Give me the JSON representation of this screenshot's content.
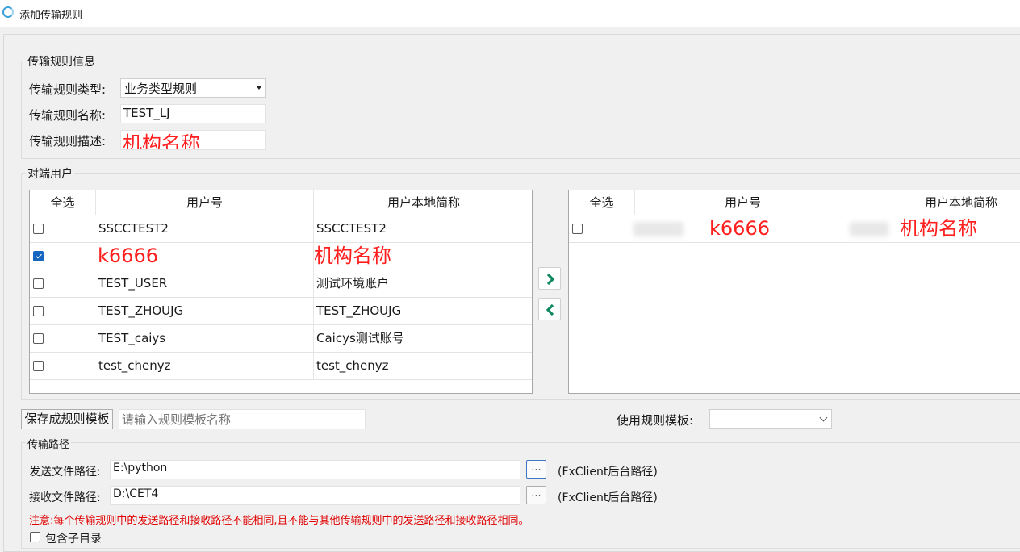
{
  "window": {
    "title": "添加传输规则"
  },
  "rule_info": {
    "group_title": "传输规则信息",
    "type_label": "传输规则类型:",
    "type_value": "业务类型规则",
    "name_label": "传输规则名称:",
    "name_value": "TEST_LJ",
    "desc_label": "传输规则描述:",
    "desc_value": "机构名称"
  },
  "peer_users": {
    "group_title": "对端用户",
    "left_table": {
      "headers": [
        "全选",
        "用户号",
        "用户本地简称"
      ],
      "rows": [
        {
          "checked": false,
          "user_id": "SSCCTEST2",
          "local_name": "SSCCTEST2"
        },
        {
          "checked": true,
          "user_id": "k6666",
          "local_name": "机构名称"
        },
        {
          "checked": false,
          "user_id": "TEST_USER",
          "local_name": "测试环境账户"
        },
        {
          "checked": false,
          "user_id": "TEST_ZHOUJG",
          "local_name": "TEST_ZHOUJG"
        },
        {
          "checked": false,
          "user_id": "TEST_caiys",
          "local_name": "Caicys测试账号"
        },
        {
          "checked": false,
          "user_id": "test_chenyz",
          "local_name": "test_chenyz"
        }
      ]
    },
    "right_table": {
      "headers": [
        "全选",
        "用户号",
        "用户本地简称"
      ],
      "rows": [
        {
          "checked": false,
          "user_id": "k6666",
          "local_name": "机构名称"
        }
      ]
    },
    "move_right_icon": "chevron-right-icon",
    "move_left_icon": "chevron-left-icon",
    "accent_color": "#0f8a5f"
  },
  "template": {
    "save_button": "保存成规则模板",
    "name_placeholder": "请输入规则模板名称",
    "use_label": "使用规则模板:",
    "use_value": ""
  },
  "paths": {
    "group_title": "传输路径",
    "send_label": "发送文件路径:",
    "send_value": "E:\\python",
    "send_hint": "(FxClient后台路径)",
    "recv_label": "接收文件路径:",
    "recv_value": "D:\\CET4",
    "recv_hint": "(FxClient后台路径)",
    "browse_label": "...",
    "note": "注意:每个传输规则中的发送路径和接收路径不能相同,且不能与其他传输规则中的发送路径和接收路径相同。",
    "include_subdir_label": "包含子目录",
    "include_subdir_checked": false
  }
}
